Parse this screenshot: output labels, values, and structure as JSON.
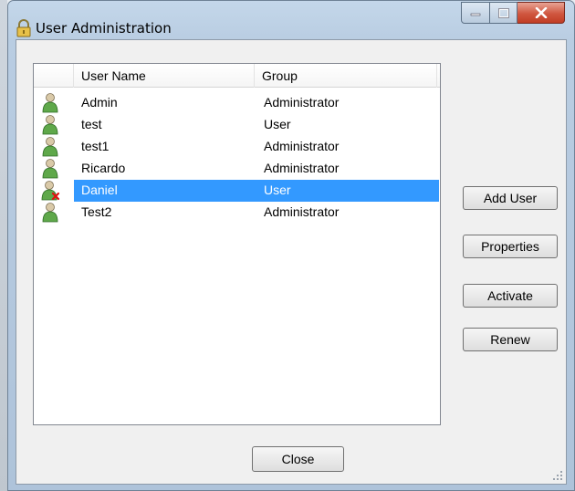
{
  "window": {
    "title": "User Administration"
  },
  "list": {
    "headers": {
      "icon": "",
      "user_name": "User Name",
      "group": "Group"
    },
    "rows": [
      {
        "name": "Admin",
        "group": "Administrator",
        "icon": "user-icon"
      },
      {
        "name": "test",
        "group": "User",
        "icon": "user-icon"
      },
      {
        "name": "test1",
        "group": "Administrator",
        "icon": "user-icon"
      },
      {
        "name": "Ricardo",
        "group": "Administrator",
        "icon": "user-icon"
      },
      {
        "name": "Daniel",
        "group": "User",
        "icon": "user-disabled-icon",
        "selected": true
      },
      {
        "name": "Test2",
        "group": "Administrator",
        "icon": "user-icon"
      }
    ]
  },
  "buttons": {
    "add_user": "Add User",
    "properties": "Properties",
    "activate": "Activate",
    "renew": "Renew",
    "close": "Close"
  },
  "colors": {
    "selection": "#3399ff",
    "close_button": "#c13d24"
  }
}
